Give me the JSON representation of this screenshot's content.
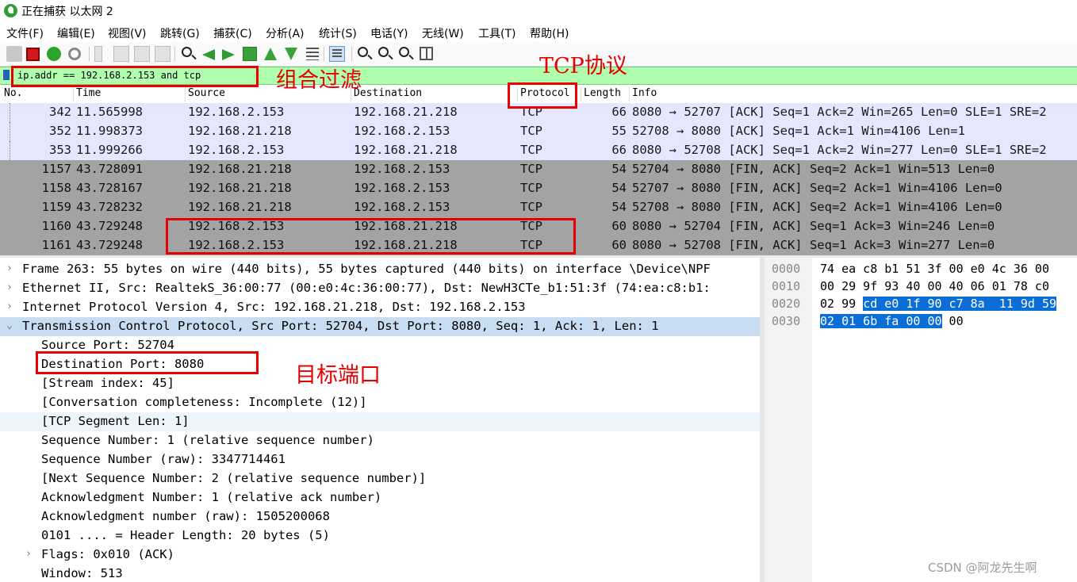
{
  "window": {
    "title": "正在捕获 以太网 2"
  },
  "menu": [
    "文件(F)",
    "编辑(E)",
    "视图(V)",
    "跳转(G)",
    "捕获(C)",
    "分析(A)",
    "统计(S)",
    "电话(Y)",
    "无线(W)",
    "工具(T)",
    "帮助(H)"
  ],
  "filter": {
    "value": "ip.addr == 192.168.2.153 and tcp"
  },
  "columns": [
    "No.",
    "Time",
    "Source",
    "Destination",
    "Protocol",
    "Length",
    "Info"
  ],
  "packets": [
    {
      "no": "342",
      "time": "11.565998",
      "src": "192.168.2.153",
      "dst": "192.168.21.218",
      "proto": "TCP",
      "len": "66",
      "info": "8080 → 52707 [ACK] Seq=1 Ack=2 Win=265 Len=0 SLE=1 SRE=2"
    },
    {
      "no": "352",
      "time": "11.998373",
      "src": "192.168.21.218",
      "dst": "192.168.2.153",
      "proto": "TCP",
      "len": "55",
      "info": "52708 → 8080 [ACK] Seq=1 Ack=1 Win=4106 Len=1"
    },
    {
      "no": "353",
      "time": "11.999266",
      "src": "192.168.2.153",
      "dst": "192.168.21.218",
      "proto": "TCP",
      "len": "66",
      "info": "8080 → 52708 [ACK] Seq=1 Ack=2 Win=277 Len=0 SLE=1 SRE=2"
    },
    {
      "no": "1157",
      "time": "43.728091",
      "src": "192.168.21.218",
      "dst": "192.168.2.153",
      "proto": "TCP",
      "len": "54",
      "info": "52704 → 8080 [FIN, ACK] Seq=2 Ack=1 Win=513 Len=0"
    },
    {
      "no": "1158",
      "time": "43.728167",
      "src": "192.168.21.218",
      "dst": "192.168.2.153",
      "proto": "TCP",
      "len": "54",
      "info": "52707 → 8080 [FIN, ACK] Seq=2 Ack=1 Win=4106 Len=0"
    },
    {
      "no": "1159",
      "time": "43.728232",
      "src": "192.168.21.218",
      "dst": "192.168.2.153",
      "proto": "TCP",
      "len": "54",
      "info": "52708 → 8080 [FIN, ACK] Seq=2 Ack=1 Win=4106 Len=0"
    },
    {
      "no": "1160",
      "time": "43.729248",
      "src": "192.168.2.153",
      "dst": "192.168.21.218",
      "proto": "TCP",
      "len": "60",
      "info": "8080 → 52704 [FIN, ACK] Seq=1 Ack=3 Win=246 Len=0"
    },
    {
      "no": "1161",
      "time": "43.729248",
      "src": "192.168.2.153",
      "dst": "192.168.21.218",
      "proto": "TCP",
      "len": "60",
      "info": "8080 → 52708 [FIN, ACK] Seq=1 Ack=3 Win=277 Len=0"
    }
  ],
  "details": [
    {
      "text": "Frame 263: 55 bytes on wire (440 bits), 55 bytes captured (440 bits) on interface \\Device\\NPF",
      "expander": "›"
    },
    {
      "text": "Ethernet II, Src: RealtekS_36:00:77 (00:e0:4c:36:00:77), Dst: NewH3CTe_b1:51:3f (74:ea:c8:b1:",
      "expander": "›"
    },
    {
      "text": "Internet Protocol Version 4, Src: 192.168.21.218, Dst: 192.168.2.153",
      "expander": "›"
    },
    {
      "text": "Transmission Control Protocol, Src Port: 52704, Dst Port: 8080, Seq: 1, Ack: 1, Len: 1",
      "expander": "⌄"
    },
    {
      "text": "Source Port: 52704",
      "expander": ""
    },
    {
      "text": "Destination Port: 8080",
      "expander": ""
    },
    {
      "text": "[Stream index: 45]",
      "expander": ""
    },
    {
      "text": "[Conversation completeness: Incomplete (12)]",
      "expander": ""
    },
    {
      "text": "[TCP Segment Len: 1]",
      "expander": ""
    },
    {
      "text": "Sequence Number: 1    (relative sequence number)",
      "expander": ""
    },
    {
      "text": "Sequence Number (raw): 3347714461",
      "expander": ""
    },
    {
      "text": "[Next Sequence Number: 2    (relative sequence number)]",
      "expander": ""
    },
    {
      "text": "Acknowledgment Number: 1    (relative ack number)",
      "expander": ""
    },
    {
      "text": "Acknowledgment number (raw): 1505200068",
      "expander": ""
    },
    {
      "text": "0101 .... = Header Length: 20 bytes (5)",
      "expander": ""
    },
    {
      "text": "Flags: 0x010 (ACK)",
      "expander": "›"
    },
    {
      "text": "Window: 513",
      "expander": ""
    }
  ],
  "bytes": [
    {
      "offset": "0000",
      "pre": "74 ea c8 b1 51 3f 00 e0  4c 36 00",
      "hl": "",
      "post": ""
    },
    {
      "offset": "0010",
      "pre": "00 29 9f 93 40 00 40 06  01 78 c0",
      "hl": "",
      "post": ""
    },
    {
      "offset": "0020",
      "pre": "02 99 ",
      "hl": "cd e0 1f 90 c7 8a  11 9d 59",
      "post": ""
    },
    {
      "offset": "0030",
      "pre": "",
      "hl": "02 01 6b fa 00 00",
      "post": " 00"
    }
  ],
  "annotations": {
    "filter_note": "组合过滤",
    "protocol_note": "TCP协议",
    "dport_note": "目标端口"
  },
  "watermark": "CSDN @阿龙先生啊",
  "colors": {
    "filter_bg": "#afffaf",
    "row_light": "#e7e6ff",
    "row_dark": "#a3a3a3",
    "selected": "#c8ddf1",
    "byte_highlight": "#0b6ed6",
    "annotation_red": "#e60000"
  }
}
